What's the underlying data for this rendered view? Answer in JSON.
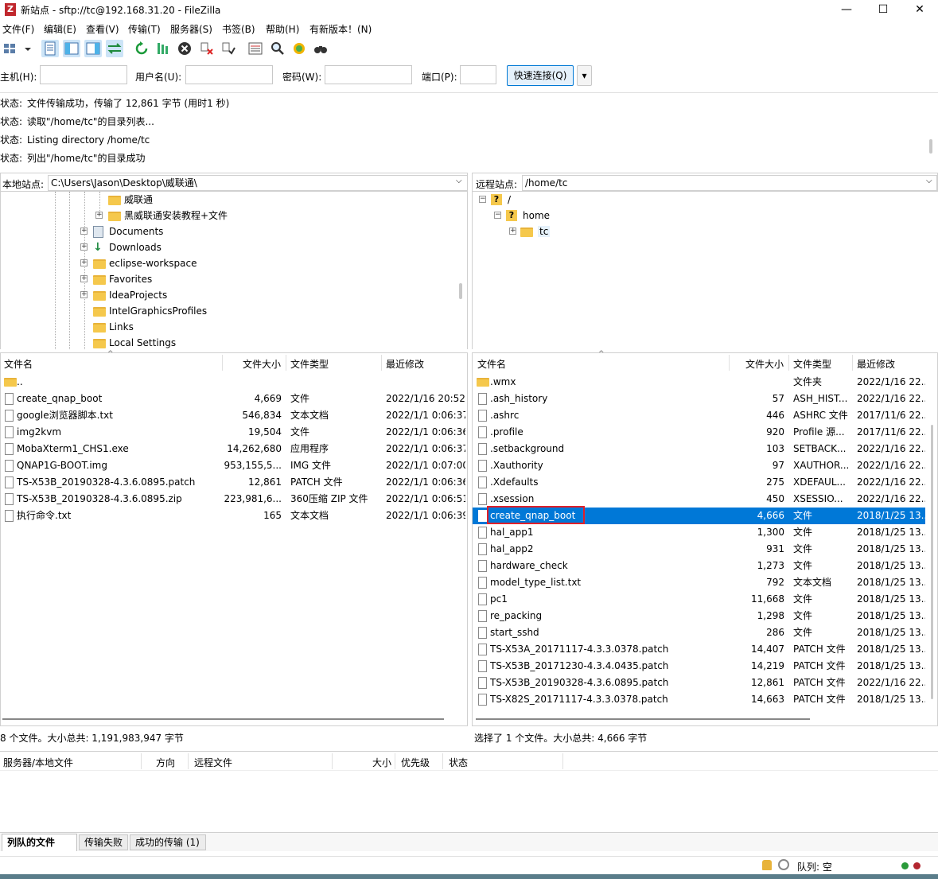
{
  "window": {
    "title": "新站点 - sftp://tc@192.168.31.20 - FileZilla",
    "minimize": "—",
    "maximize": "☐",
    "close": "✕"
  },
  "menu": [
    "文件(F)",
    "编辑(E)",
    "查看(V)",
    "传输(T)",
    "服务器(S)",
    "书签(B)",
    "帮助(H)",
    "有新版本！(N)"
  ],
  "quickconnect": {
    "host_label": "主机(H):",
    "user_label": "用户名(U):",
    "pass_label": "密码(W):",
    "port_label": "端口(P):",
    "connect_button": "快速连接(Q)",
    "dropdown": "▾"
  },
  "log": [
    {
      "label": "状态:",
      "text": "文件传输成功，传输了 12,861 字节 (用时1 秒)"
    },
    {
      "label": "状态:",
      "text": "读取\"/home/tc\"的目录列表..."
    },
    {
      "label": "状态:",
      "text": "Listing directory /home/tc"
    },
    {
      "label": "状态:",
      "text": "列出\"/home/tc\"的目录成功"
    }
  ],
  "local": {
    "site_label": "本地站点:",
    "path": "C:\\Users\\Jason\\Desktop\\威联通\\",
    "tree": [
      "威联通",
      "黑威联通安装教程+文件",
      "Documents",
      "Downloads",
      "eclipse-workspace",
      "Favorites",
      "IdeaProjects",
      "IntelGraphicsProfiles",
      "Links",
      "Local Settings"
    ],
    "columns": [
      "文件名",
      "文件大小",
      "文件类型",
      "最近修改"
    ],
    "parent": "..",
    "files": [
      {
        "name": "create_qnap_boot",
        "size": "4,669",
        "type": "文件",
        "modified": "2022/1/16 20:52:.."
      },
      {
        "name": "google浏览器脚本.txt",
        "size": "546,834",
        "type": "文本文档",
        "modified": "2022/1/1 0:06:37"
      },
      {
        "name": "img2kvm",
        "size": "19,504",
        "type": "文件",
        "modified": "2022/1/1 0:06:36"
      },
      {
        "name": "MobaXterm1_CHS1.exe",
        "size": "14,262,680",
        "type": "应用程序",
        "modified": "2022/1/1 0:06:37"
      },
      {
        "name": "QNAP1G-BOOT.img",
        "size": "953,155,5...",
        "type": "IMG 文件",
        "modified": "2022/1/1 0:07:00"
      },
      {
        "name": "TS-X53B_20190328-4.3.6.0895.patch",
        "size": "12,861",
        "type": "PATCH 文件",
        "modified": "2022/1/1 0:06:36"
      },
      {
        "name": "TS-X53B_20190328-4.3.6.0895.zip",
        "size": "223,981,6...",
        "type": "360压缩 ZIP 文件",
        "modified": "2022/1/1 0:06:51"
      },
      {
        "name": "执行命令.txt",
        "size": "165",
        "type": "文本文档",
        "modified": "2022/1/1 0:06:39"
      }
    ],
    "status": "8 个文件。大小总共: 1,191,983,947 字节"
  },
  "remote": {
    "site_label": "远程站点:",
    "path": "/home/tc",
    "tree": [
      "/",
      "home",
      "tc"
    ],
    "columns": [
      "文件名",
      "文件大小",
      "文件类型",
      "最近修改"
    ],
    "files": [
      {
        "name": ".wmx",
        "size": "",
        "type": "文件夹",
        "modified": "2022/1/16 22..",
        "folder": true
      },
      {
        "name": ".ash_history",
        "size": "57",
        "type": "ASH_HIST...",
        "modified": "2022/1/16 22.."
      },
      {
        "name": ".ashrc",
        "size": "446",
        "type": "ASHRC 文件",
        "modified": "2017/11/6 22.."
      },
      {
        "name": ".profile",
        "size": "920",
        "type": "Profile 源...",
        "modified": "2017/11/6 22.."
      },
      {
        "name": ".setbackground",
        "size": "103",
        "type": "SETBACK...",
        "modified": "2022/1/16 22.."
      },
      {
        "name": ".Xauthority",
        "size": "97",
        "type": "XAUTHOR...",
        "modified": "2022/1/16 22.."
      },
      {
        "name": ".Xdefaults",
        "size": "275",
        "type": "XDEFAUL...",
        "modified": "2022/1/16 22.."
      },
      {
        "name": ".xsession",
        "size": "450",
        "type": "XSESSIO...",
        "modified": "2022/1/16 22.."
      },
      {
        "name": "create_qnap_boot",
        "size": "4,666",
        "type": "文件",
        "modified": "2018/1/25 13..",
        "selected": true
      },
      {
        "name": "hal_app1",
        "size": "1,300",
        "type": "文件",
        "modified": "2018/1/25 13.."
      },
      {
        "name": "hal_app2",
        "size": "931",
        "type": "文件",
        "modified": "2018/1/25 13.."
      },
      {
        "name": "hardware_check",
        "size": "1,273",
        "type": "文件",
        "modified": "2018/1/25 13.."
      },
      {
        "name": "model_type_list.txt",
        "size": "792",
        "type": "文本文档",
        "modified": "2018/1/25 13.."
      },
      {
        "name": "pc1",
        "size": "11,668",
        "type": "文件",
        "modified": "2018/1/25 13.."
      },
      {
        "name": "re_packing",
        "size": "1,298",
        "type": "文件",
        "modified": "2018/1/25 13.."
      },
      {
        "name": "start_sshd",
        "size": "286",
        "type": "文件",
        "modified": "2018/1/25 13.."
      },
      {
        "name": "TS-X53A_20171117-4.3.3.0378.patch",
        "size": "14,407",
        "type": "PATCH 文件",
        "modified": "2018/1/25 13.."
      },
      {
        "name": "TS-X53B_20171230-4.3.4.0435.patch",
        "size": "14,219",
        "type": "PATCH 文件",
        "modified": "2018/1/25 13.."
      },
      {
        "name": "TS-X53B_20190328-4.3.6.0895.patch",
        "size": "12,861",
        "type": "PATCH 文件",
        "modified": "2022/1/16 22.."
      },
      {
        "name": "TS-X82S_20171117-4.3.3.0378.patch",
        "size": "14,663",
        "type": "PATCH 文件",
        "modified": "2018/1/25 13.."
      }
    ],
    "status": "选择了 1 个文件。大小总共: 4,666 字节"
  },
  "queue": {
    "columns": [
      "服务器/本地文件",
      "方向",
      "远程文件",
      "大小",
      "优先级",
      "状态"
    ],
    "tabs": [
      "列队的文件",
      "传输失败",
      "成功的传输 (1)"
    ]
  },
  "statusbar": {
    "queue": "队列: 空"
  },
  "colors": {
    "selection": "#0078d7",
    "highlight_box": "#e0202a",
    "folder": "#f5c84c"
  }
}
